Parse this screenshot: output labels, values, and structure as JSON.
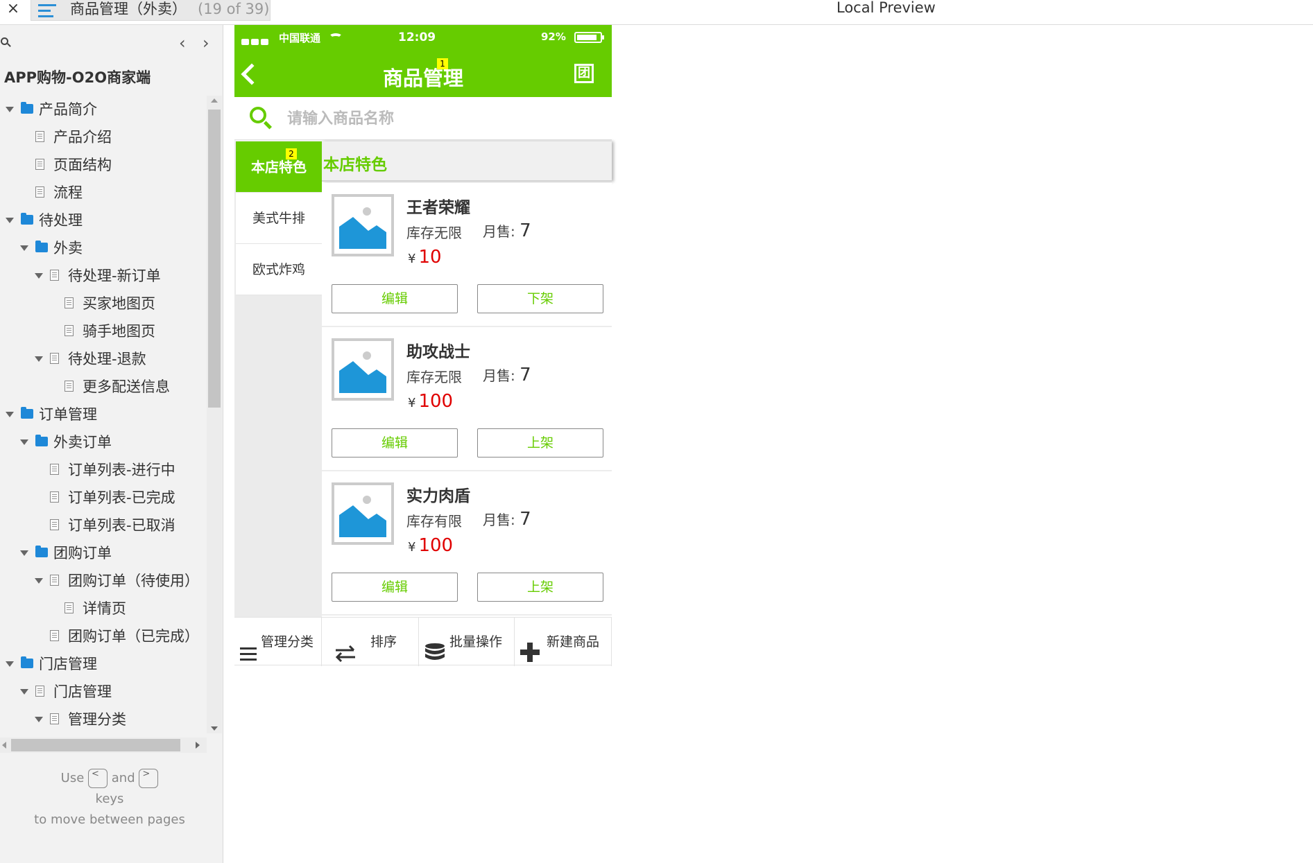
{
  "topbar": {
    "close": "×",
    "title": "商品管理（外卖）",
    "count": "(19 of 39)",
    "preview": "Local Preview"
  },
  "sidebar": {
    "prev": "‹",
    "next": "›",
    "project": "APP购物-O2O商家端",
    "tree": [
      {
        "label": "产品简介",
        "level": 0,
        "type": "folder",
        "expanded": true
      },
      {
        "label": "产品介绍",
        "level": 1,
        "type": "page",
        "expanded": false
      },
      {
        "label": "页面结构",
        "level": 1,
        "type": "page",
        "expanded": false
      },
      {
        "label": "流程",
        "level": 1,
        "type": "page",
        "expanded": false
      },
      {
        "label": "待处理",
        "level": 0,
        "type": "folder",
        "expanded": true
      },
      {
        "label": "外卖",
        "level": 1,
        "type": "folder",
        "expanded": true
      },
      {
        "label": "待处理-新订单",
        "level": 2,
        "type": "page",
        "expanded": true
      },
      {
        "label": "买家地图页",
        "level": 3,
        "type": "page",
        "expanded": false
      },
      {
        "label": "骑手地图页",
        "level": 3,
        "type": "page",
        "expanded": false
      },
      {
        "label": "待处理-退款",
        "level": 2,
        "type": "page",
        "expanded": true
      },
      {
        "label": "更多配送信息",
        "level": 3,
        "type": "page",
        "expanded": false
      },
      {
        "label": "订单管理",
        "level": 0,
        "type": "folder",
        "expanded": true
      },
      {
        "label": "外卖订单",
        "level": 1,
        "type": "folder",
        "expanded": true
      },
      {
        "label": "订单列表-进行中",
        "level": 2,
        "type": "page",
        "expanded": false
      },
      {
        "label": "订单列表-已完成",
        "level": 2,
        "type": "page",
        "expanded": false
      },
      {
        "label": "订单列表-已取消",
        "level": 2,
        "type": "page",
        "expanded": false
      },
      {
        "label": "团购订单",
        "level": 1,
        "type": "folder",
        "expanded": true
      },
      {
        "label": "团购订单（待使用）",
        "level": 2,
        "type": "page",
        "expanded": true
      },
      {
        "label": "详情页",
        "level": 3,
        "type": "page",
        "expanded": false
      },
      {
        "label": "团购订单（已完成）",
        "level": 2,
        "type": "page",
        "expanded": false
      },
      {
        "label": "门店管理",
        "level": 0,
        "type": "folder",
        "expanded": true
      },
      {
        "label": "门店管理",
        "level": 1,
        "type": "page",
        "expanded": true
      },
      {
        "label": "管理分类",
        "level": 2,
        "type": "page",
        "expanded": true
      }
    ],
    "hint": {
      "use": "Use",
      "prev_key": "<",
      "and": "and",
      "next_key": ">",
      "keys": "keys",
      "rest": "to move between pages"
    }
  },
  "phone": {
    "status": {
      "carrier": "中国联通",
      "time": "12:09",
      "battery": "92%"
    },
    "nav": {
      "title": "商品管理",
      "marker": "1",
      "right_icon": "团"
    },
    "search": {
      "placeholder": "请输入商品名称"
    },
    "categories": [
      {
        "label": "本店特色",
        "active": true,
        "marker": "2"
      },
      {
        "label": "美式牛排",
        "active": false
      },
      {
        "label": "欧式炸鸡",
        "active": false
      }
    ],
    "section_title": "本店特色",
    "products": [
      {
        "name": "王者荣耀",
        "stock": "库存无限",
        "sold_label": "月售:",
        "sold": "7",
        "currency": "¥",
        "price": "10",
        "edit": "编辑",
        "toggle": "下架"
      },
      {
        "name": "助攻战士",
        "stock": "库存无限",
        "sold_label": "月售:",
        "sold": "7",
        "currency": "¥",
        "price": "100",
        "edit": "编辑",
        "toggle": "上架"
      },
      {
        "name": "实力肉盾",
        "stock": "库存有限",
        "sold_label": "月售:",
        "sold": "7",
        "currency": "¥",
        "price": "100",
        "edit": "编辑",
        "toggle": "上架"
      }
    ],
    "toolbar": [
      {
        "label": "管理分类",
        "icon": "menu-icon"
      },
      {
        "label": "排序",
        "icon": "swap-icon"
      },
      {
        "label": "批量操作",
        "icon": "database-icon"
      },
      {
        "label": "新建商品",
        "icon": "plus-icon"
      }
    ]
  },
  "colors": {
    "accent": "#66cc00",
    "price": "#e00000",
    "folder": "#1e88d8"
  }
}
